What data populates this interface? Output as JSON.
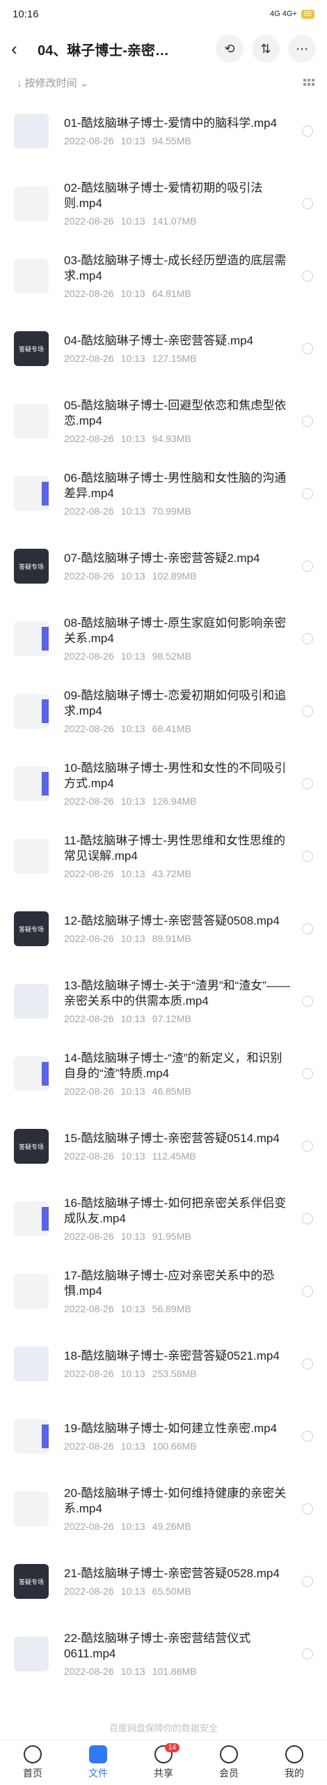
{
  "status": {
    "time": "10:16",
    "indicators": "4G 4G+",
    "battery": "65"
  },
  "header": {
    "title": "04、琳子博士-亲密…"
  },
  "sort": {
    "label": "按修改时间"
  },
  "files": [
    {
      "name": "01-酷炫脑琳子博士-爱情中的脑科学.mp4",
      "date": "2022-08-26",
      "time": "10:13",
      "size": "94.55MB",
      "thumb": "light"
    },
    {
      "name": "02-酷炫脑琳子博士-爱情初期的吸引法则.mp4",
      "date": "2022-08-26",
      "time": "10:13",
      "size": "141.07MB",
      "thumb": "pale"
    },
    {
      "name": "03-酷炫脑琳子博士-成长经历塑造的底层需求.mp4",
      "date": "2022-08-26",
      "time": "10:13",
      "size": "64.81MB",
      "thumb": "pale"
    },
    {
      "name": "04-酷炫脑琳子博士-亲密营答疑.mp4",
      "date": "2022-08-26",
      "time": "10:13",
      "size": "127.15MB",
      "thumb": "dark",
      "thumb_text": "答疑专场"
    },
    {
      "name": "05-酷炫脑琳子博士-回避型依恋和焦虑型依恋.mp4",
      "date": "2022-08-26",
      "time": "10:13",
      "size": "94.93MB",
      "thumb": "pale"
    },
    {
      "name": "06-酷炫脑琳子博士-男性脑和女性脑的沟通差异.mp4",
      "date": "2022-08-26",
      "time": "10:13",
      "size": "70.99MB",
      "thumb": "bar"
    },
    {
      "name": "07-酷炫脑琳子博士-亲密营答疑2.mp4",
      "date": "2022-08-26",
      "time": "10:13",
      "size": "102.89MB",
      "thumb": "dark",
      "thumb_text": "答疑专场"
    },
    {
      "name": "08-酷炫脑琳子博士-原生家庭如何影响亲密关系.mp4",
      "date": "2022-08-26",
      "time": "10:13",
      "size": "98.52MB",
      "thumb": "bar"
    },
    {
      "name": "09-酷炫脑琳子博士-恋爱初期如何吸引和追求.mp4",
      "date": "2022-08-26",
      "time": "10:13",
      "size": "68.41MB",
      "thumb": "bar"
    },
    {
      "name": "10-酷炫脑琳子博士-男性和女性的不同吸引方式.mp4",
      "date": "2022-08-26",
      "time": "10:13",
      "size": "126.94MB",
      "thumb": "bar"
    },
    {
      "name": "11-酷炫脑琳子博士-男性思维和女性思维的常见误解.mp4",
      "date": "2022-08-26",
      "time": "10:13",
      "size": "43.72MB",
      "thumb": "pale"
    },
    {
      "name": "12-酷炫脑琳子博士-亲密营答疑0508.mp4",
      "date": "2022-08-26",
      "time": "10:13",
      "size": "89.91MB",
      "thumb": "dark",
      "thumb_text": "答疑专场"
    },
    {
      "name": "13-酷炫脑琳子博士-关于“渣男”和“渣女”——亲密关系中的供需本质.mp4",
      "date": "2022-08-26",
      "time": "10:13",
      "size": "97.12MB",
      "thumb": "light"
    },
    {
      "name": "14-酷炫脑琳子博士-“渣”的新定义，和识别自身的“渣”特质.mp4",
      "date": "2022-08-26",
      "time": "10:13",
      "size": "46.85MB",
      "thumb": "bar"
    },
    {
      "name": "15-酷炫脑琳子博士-亲密营答疑0514.mp4",
      "date": "2022-08-26",
      "time": "10:13",
      "size": "112.45MB",
      "thumb": "dark",
      "thumb_text": "答疑专场"
    },
    {
      "name": "16-酷炫脑琳子博士-如何把亲密关系伴侣变成队友.mp4",
      "date": "2022-08-26",
      "time": "10:13",
      "size": "91.95MB",
      "thumb": "bar"
    },
    {
      "name": "17-酷炫脑琳子博士-应对亲密关系中的恐惧.mp4",
      "date": "2022-08-26",
      "time": "10:13",
      "size": "56.89MB",
      "thumb": "pale"
    },
    {
      "name": "18-酷炫脑琳子博士-亲密营答疑0521.mp4",
      "date": "2022-08-26",
      "time": "10:13",
      "size": "253.58MB",
      "thumb": "light"
    },
    {
      "name": "19-酷炫脑琳子博士-如何建立性亲密.mp4",
      "date": "2022-08-26",
      "time": "10:13",
      "size": "100.66MB",
      "thumb": "bar"
    },
    {
      "name": "20-酷炫脑琳子博士-如何维持健康的亲密关系.mp4",
      "date": "2022-08-26",
      "time": "10:13",
      "size": "49.26MB",
      "thumb": "pale"
    },
    {
      "name": "21-酷炫脑琳子博士-亲密营答疑0528.mp4",
      "date": "2022-08-26",
      "time": "10:13",
      "size": "65.50MB",
      "thumb": "dark",
      "thumb_text": "答疑专场"
    },
    {
      "name": "22-酷炫脑琳子博士-亲密营结营仪式0611.mp4",
      "date": "2022-08-26",
      "time": "10:13",
      "size": "101.86MB",
      "thumb": "light"
    }
  ],
  "footnote": "百度网盘保障你的数据安全",
  "tabs": [
    {
      "label": "首页"
    },
    {
      "label": "文件"
    },
    {
      "label": "共享",
      "badge": "14"
    },
    {
      "label": "会员"
    },
    {
      "label": "我的"
    }
  ]
}
